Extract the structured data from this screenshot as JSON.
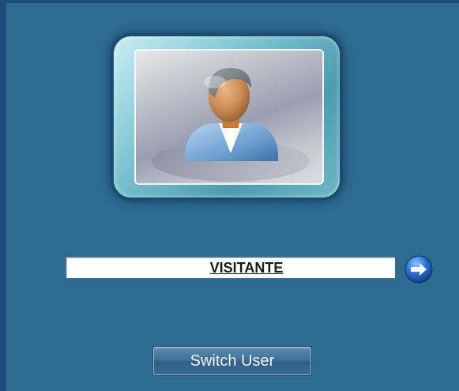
{
  "login": {
    "username": "VISITANTE",
    "switch_user_label": "Switch User"
  },
  "icons": {
    "avatar": "user-avatar-icon",
    "go": "arrow-right-circle-icon"
  },
  "colors": {
    "background": "#2e6b91",
    "frame": "#1e4a7c",
    "go_button": "#1e5fb8"
  }
}
